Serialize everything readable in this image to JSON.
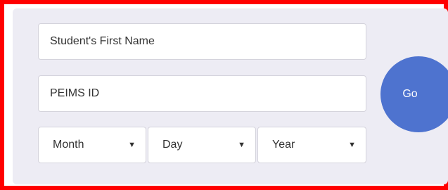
{
  "form": {
    "first_name_placeholder": "Student's First Name",
    "peims_placeholder": "PEIMS ID",
    "month_label": "Month",
    "day_label": "Day",
    "year_label": "Year",
    "go_label": "Go"
  },
  "icons": {
    "dropdown": "chevron-down-icon"
  },
  "colors": {
    "frame_border": "#ff0000",
    "panel_background": "#edecf4",
    "go_button": "#4e73cf"
  }
}
